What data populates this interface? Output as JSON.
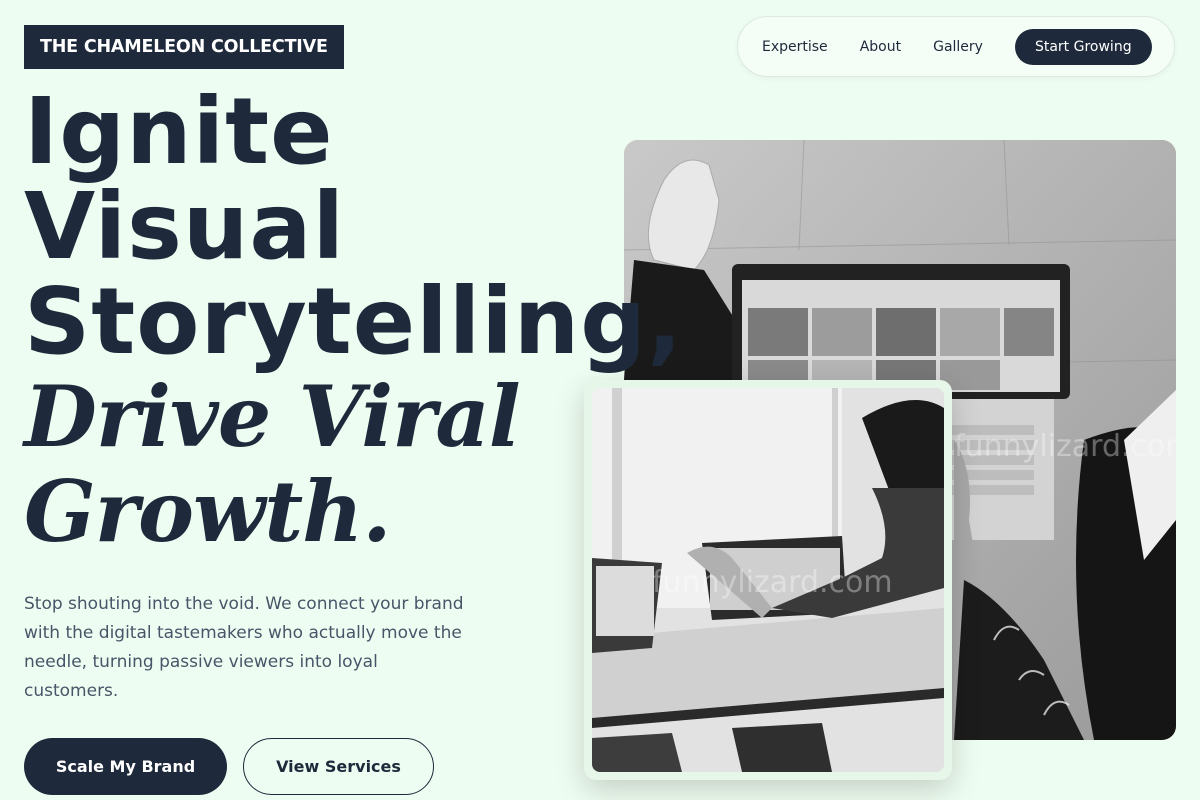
{
  "brand": {
    "logo_text": "THE CHAMELEON COLLECTIVE"
  },
  "nav": {
    "links": [
      "Expertise",
      "About",
      "Gallery"
    ],
    "cta_label": "Start Growing"
  },
  "hero": {
    "title_lines": [
      "Ignite",
      "Visual",
      "Storytelling,"
    ],
    "title_italic_lines": [
      "Drive Viral",
      "Growth."
    ],
    "description": "Stop shouting into the void. We connect your brand with the digital tastemakers who actually move the needle, turning passive viewers into loyal customers.",
    "primary_button": "Scale My Brand",
    "secondary_button": "View Services"
  },
  "images": {
    "main_watermark": "funnylizard.com",
    "small_watermark": "funnylizard.com"
  },
  "colors": {
    "background": "#eefdf1",
    "primary": "#1e293b",
    "text_muted": "#475569"
  }
}
